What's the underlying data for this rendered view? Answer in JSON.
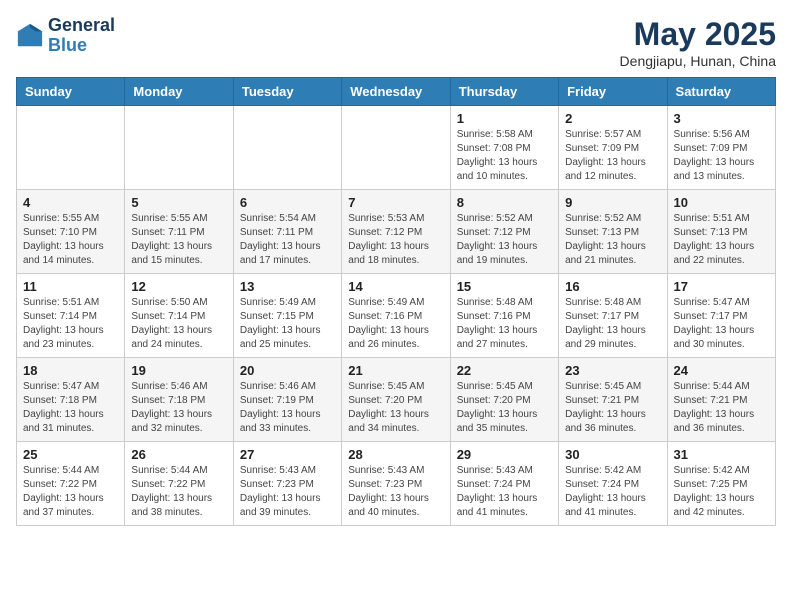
{
  "header": {
    "logo_line1": "General",
    "logo_line2": "Blue",
    "month_title": "May 2025",
    "location": "Dengjiapu, Hunan, China"
  },
  "weekdays": [
    "Sunday",
    "Monday",
    "Tuesday",
    "Wednesday",
    "Thursday",
    "Friday",
    "Saturday"
  ],
  "weeks": [
    [
      {
        "day": "",
        "info": ""
      },
      {
        "day": "",
        "info": ""
      },
      {
        "day": "",
        "info": ""
      },
      {
        "day": "",
        "info": ""
      },
      {
        "day": "1",
        "info": "Sunrise: 5:58 AM\nSunset: 7:08 PM\nDaylight: 13 hours\nand 10 minutes."
      },
      {
        "day": "2",
        "info": "Sunrise: 5:57 AM\nSunset: 7:09 PM\nDaylight: 13 hours\nand 12 minutes."
      },
      {
        "day": "3",
        "info": "Sunrise: 5:56 AM\nSunset: 7:09 PM\nDaylight: 13 hours\nand 13 minutes."
      }
    ],
    [
      {
        "day": "4",
        "info": "Sunrise: 5:55 AM\nSunset: 7:10 PM\nDaylight: 13 hours\nand 14 minutes."
      },
      {
        "day": "5",
        "info": "Sunrise: 5:55 AM\nSunset: 7:11 PM\nDaylight: 13 hours\nand 15 minutes."
      },
      {
        "day": "6",
        "info": "Sunrise: 5:54 AM\nSunset: 7:11 PM\nDaylight: 13 hours\nand 17 minutes."
      },
      {
        "day": "7",
        "info": "Sunrise: 5:53 AM\nSunset: 7:12 PM\nDaylight: 13 hours\nand 18 minutes."
      },
      {
        "day": "8",
        "info": "Sunrise: 5:52 AM\nSunset: 7:12 PM\nDaylight: 13 hours\nand 19 minutes."
      },
      {
        "day": "9",
        "info": "Sunrise: 5:52 AM\nSunset: 7:13 PM\nDaylight: 13 hours\nand 21 minutes."
      },
      {
        "day": "10",
        "info": "Sunrise: 5:51 AM\nSunset: 7:13 PM\nDaylight: 13 hours\nand 22 minutes."
      }
    ],
    [
      {
        "day": "11",
        "info": "Sunrise: 5:51 AM\nSunset: 7:14 PM\nDaylight: 13 hours\nand 23 minutes."
      },
      {
        "day": "12",
        "info": "Sunrise: 5:50 AM\nSunset: 7:14 PM\nDaylight: 13 hours\nand 24 minutes."
      },
      {
        "day": "13",
        "info": "Sunrise: 5:49 AM\nSunset: 7:15 PM\nDaylight: 13 hours\nand 25 minutes."
      },
      {
        "day": "14",
        "info": "Sunrise: 5:49 AM\nSunset: 7:16 PM\nDaylight: 13 hours\nand 26 minutes."
      },
      {
        "day": "15",
        "info": "Sunrise: 5:48 AM\nSunset: 7:16 PM\nDaylight: 13 hours\nand 27 minutes."
      },
      {
        "day": "16",
        "info": "Sunrise: 5:48 AM\nSunset: 7:17 PM\nDaylight: 13 hours\nand 29 minutes."
      },
      {
        "day": "17",
        "info": "Sunrise: 5:47 AM\nSunset: 7:17 PM\nDaylight: 13 hours\nand 30 minutes."
      }
    ],
    [
      {
        "day": "18",
        "info": "Sunrise: 5:47 AM\nSunset: 7:18 PM\nDaylight: 13 hours\nand 31 minutes."
      },
      {
        "day": "19",
        "info": "Sunrise: 5:46 AM\nSunset: 7:18 PM\nDaylight: 13 hours\nand 32 minutes."
      },
      {
        "day": "20",
        "info": "Sunrise: 5:46 AM\nSunset: 7:19 PM\nDaylight: 13 hours\nand 33 minutes."
      },
      {
        "day": "21",
        "info": "Sunrise: 5:45 AM\nSunset: 7:20 PM\nDaylight: 13 hours\nand 34 minutes."
      },
      {
        "day": "22",
        "info": "Sunrise: 5:45 AM\nSunset: 7:20 PM\nDaylight: 13 hours\nand 35 minutes."
      },
      {
        "day": "23",
        "info": "Sunrise: 5:45 AM\nSunset: 7:21 PM\nDaylight: 13 hours\nand 36 minutes."
      },
      {
        "day": "24",
        "info": "Sunrise: 5:44 AM\nSunset: 7:21 PM\nDaylight: 13 hours\nand 36 minutes."
      }
    ],
    [
      {
        "day": "25",
        "info": "Sunrise: 5:44 AM\nSunset: 7:22 PM\nDaylight: 13 hours\nand 37 minutes."
      },
      {
        "day": "26",
        "info": "Sunrise: 5:44 AM\nSunset: 7:22 PM\nDaylight: 13 hours\nand 38 minutes."
      },
      {
        "day": "27",
        "info": "Sunrise: 5:43 AM\nSunset: 7:23 PM\nDaylight: 13 hours\nand 39 minutes."
      },
      {
        "day": "28",
        "info": "Sunrise: 5:43 AM\nSunset: 7:23 PM\nDaylight: 13 hours\nand 40 minutes."
      },
      {
        "day": "29",
        "info": "Sunrise: 5:43 AM\nSunset: 7:24 PM\nDaylight: 13 hours\nand 41 minutes."
      },
      {
        "day": "30",
        "info": "Sunrise: 5:42 AM\nSunset: 7:24 PM\nDaylight: 13 hours\nand 41 minutes."
      },
      {
        "day": "31",
        "info": "Sunrise: 5:42 AM\nSunset: 7:25 PM\nDaylight: 13 hours\nand 42 minutes."
      }
    ]
  ]
}
